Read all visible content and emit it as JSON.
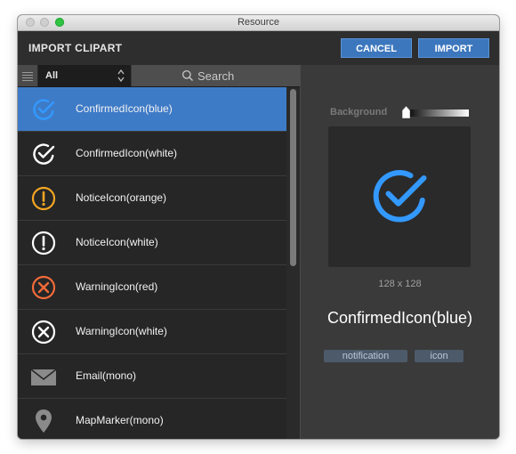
{
  "window": {
    "title": "Resource"
  },
  "header": {
    "title": "IMPORT CLIPART",
    "cancel_label": "CANCEL",
    "import_label": "IMPORT"
  },
  "toolbar": {
    "filter_value": "All",
    "search_placeholder": "Search"
  },
  "items": [
    {
      "label": "ConfirmedIcon(blue)",
      "icon": "confirmed-icon",
      "color": "#3399ff",
      "selected": true
    },
    {
      "label": "ConfirmedIcon(white)",
      "icon": "confirmed-icon",
      "color": "#ffffff",
      "selected": false
    },
    {
      "label": "NoticeIcon(orange)",
      "icon": "notice-icon",
      "color": "#f5a623",
      "selected": false
    },
    {
      "label": "NoticeIcon(white)",
      "icon": "notice-icon",
      "color": "#ffffff",
      "selected": false
    },
    {
      "label": "WarningIcon(red)",
      "icon": "warning-icon",
      "color": "#f26b3a",
      "selected": false
    },
    {
      "label": "WarningIcon(white)",
      "icon": "warning-icon",
      "color": "#ffffff",
      "selected": false
    },
    {
      "label": "Email(mono)",
      "icon": "envelope-icon",
      "color": "#8a8a8a",
      "selected": false
    },
    {
      "label": "MapMarker(mono)",
      "icon": "map-marker-icon",
      "color": "#8a8a8a",
      "selected": false
    }
  ],
  "preview": {
    "background_label": "Background",
    "background_level": 0,
    "dimensions": "128 x 128",
    "name": "ConfirmedIcon(blue)",
    "icon": "confirmed-icon",
    "color": "#3399ff",
    "tags": [
      "notification",
      "icon"
    ]
  }
}
